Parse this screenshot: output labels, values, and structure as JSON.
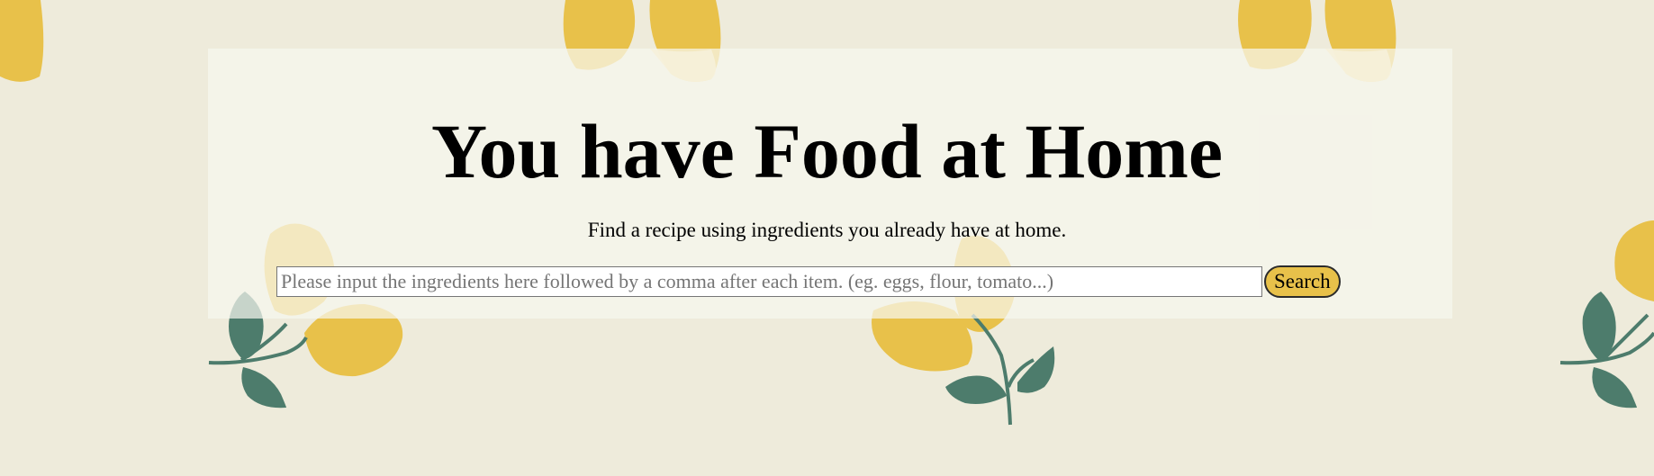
{
  "header": {
    "title": "You have Food at Home",
    "subtitle": "Find a recipe using ingredients you already have at home."
  },
  "search": {
    "placeholder": "Please input the ingredients here followed by a comma after each item. (eg. eggs, flour, tomato...)",
    "value": "",
    "button_label": "Search"
  },
  "theme": {
    "background": "#eeebdb",
    "lemon": "#e8c14a",
    "lemon_light": "#f3dc97",
    "leaf": "#4d7c6c",
    "panel": "#f7f6ee"
  }
}
